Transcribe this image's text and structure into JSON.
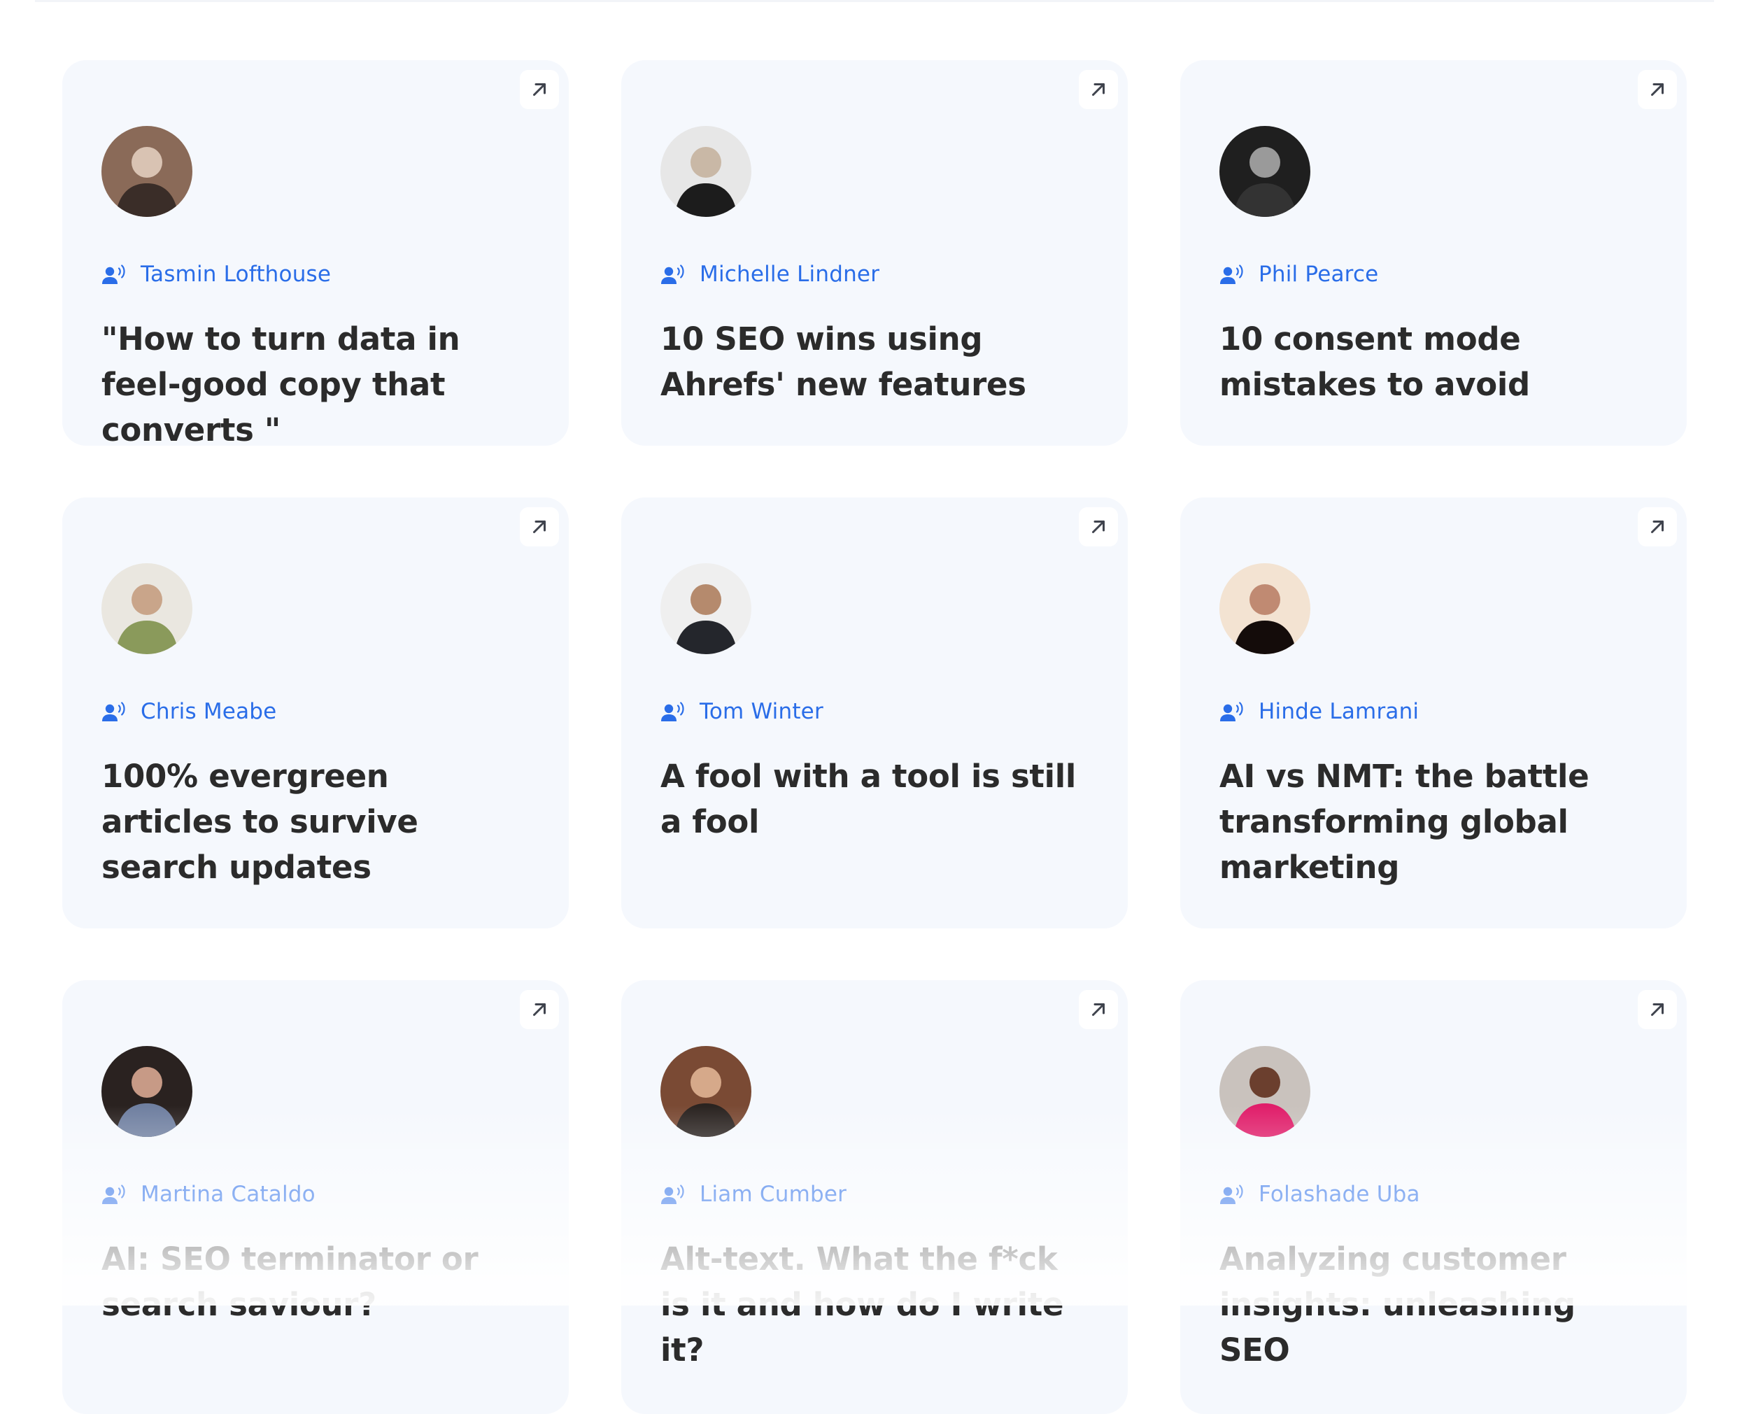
{
  "accent_color": "#2a6de8",
  "card_background": "#f5f8fd",
  "title_color": "#2b2b2b",
  "cards": [
    {
      "author": "Tasmin Lofthouse",
      "title": "\"How to turn data in feel-good copy that converts \"",
      "avatar": {
        "icon": "avatar-photo",
        "colors": [
          "#8a6a58",
          "#d9c3b3",
          "#3a2d28"
        ]
      },
      "link_icon": "arrow-up-right-icon",
      "author_icon": "record-voice-icon"
    },
    {
      "author": "Michelle Lindner",
      "title": "10 SEO wins using Ahrefs' new features",
      "avatar": {
        "icon": "avatar-photo",
        "colors": [
          "#e7e7e7",
          "#c9b8a6",
          "#1c1c1c"
        ]
      },
      "link_icon": "arrow-up-right-icon",
      "author_icon": "record-voice-icon"
    },
    {
      "author": "Phil Pearce",
      "title": "10 consent mode mistakes to avoid",
      "avatar": {
        "icon": "avatar-photo",
        "colors": [
          "#1f1f1f",
          "#9a9a9a",
          "#333333"
        ]
      },
      "link_icon": "arrow-up-right-icon",
      "author_icon": "record-voice-icon"
    },
    {
      "author": "Chris Meabe",
      "title": "100% evergreen articles to survive search updates",
      "avatar": {
        "icon": "avatar-photo",
        "colors": [
          "#eae7e0",
          "#c9a58a",
          "#8a9a5b"
        ]
      },
      "link_icon": "arrow-up-right-icon",
      "author_icon": "record-voice-icon"
    },
    {
      "author": "Tom Winter",
      "title": "A fool with a tool is still a fool",
      "avatar": {
        "icon": "avatar-photo",
        "colors": [
          "#efefef",
          "#b58a6d",
          "#24262c"
        ]
      },
      "link_icon": "arrow-up-right-icon",
      "author_icon": "record-voice-icon"
    },
    {
      "author": "Hinde Lamrani",
      "title": "AI vs NMT: the battle transforming global marketing",
      "avatar": {
        "icon": "avatar-photo",
        "colors": [
          "#f3e3d2",
          "#c08a72",
          "#140c0a"
        ]
      },
      "link_icon": "arrow-up-right-icon",
      "author_icon": "record-voice-icon"
    },
    {
      "author": "Martina Cataldo",
      "title": "AI: SEO terminator or search saviour?",
      "avatar": {
        "icon": "avatar-photo",
        "colors": [
          "#2a2220",
          "#c79a86",
          "#6f7fa0"
        ]
      },
      "link_icon": "arrow-up-right-icon",
      "author_icon": "record-voice-icon"
    },
    {
      "author": "Liam Cumber",
      "title": "Alt-text. What the f*ck is it and how do I write it?",
      "avatar": {
        "icon": "avatar-photo",
        "colors": [
          "#7a4a34",
          "#d6a98a",
          "#2a2320"
        ]
      },
      "link_icon": "arrow-up-right-icon",
      "author_icon": "record-voice-icon"
    },
    {
      "author": "Folashade Uba",
      "title": "Analyzing customer insights: unleashing SEO",
      "avatar": {
        "icon": "avatar-photo",
        "colors": [
          "#c9c2bd",
          "#6b3f2e",
          "#e01e6a"
        ]
      },
      "link_icon": "arrow-up-right-icon",
      "author_icon": "record-voice-icon"
    }
  ]
}
